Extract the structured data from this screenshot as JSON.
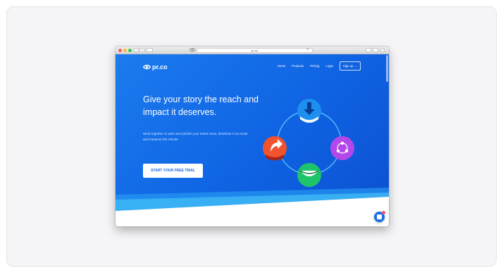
{
  "browser": {
    "url": "pr.co",
    "tab_icon": "eye-icon"
  },
  "site": {
    "logo_text": "pr.co",
    "nav": [
      {
        "label": "Home"
      },
      {
        "label": "Products"
      },
      {
        "label": "Pricing"
      },
      {
        "label": "Login"
      }
    ],
    "signup_label": "Sign up →"
  },
  "hero": {
    "title": "Give your story the reach and impact it deserves.",
    "subtitle": "Work together to write and publish your latest news, distribute it via email, and measure the results.",
    "cta_label": "START YOUR FREE TRIAL"
  },
  "illustration": {
    "icons": [
      {
        "name": "download-icon",
        "color": "#1f8ef1"
      },
      {
        "name": "share-icon",
        "color": "#f0532d"
      },
      {
        "name": "network-icon",
        "color": "#b347ea"
      },
      {
        "name": "smile-icon",
        "color": "#1ec46a"
      }
    ]
  },
  "colors": {
    "hero_bg": "#1466e8",
    "cta_text": "#1a66e6",
    "chat_button": "#1a6ee8"
  }
}
